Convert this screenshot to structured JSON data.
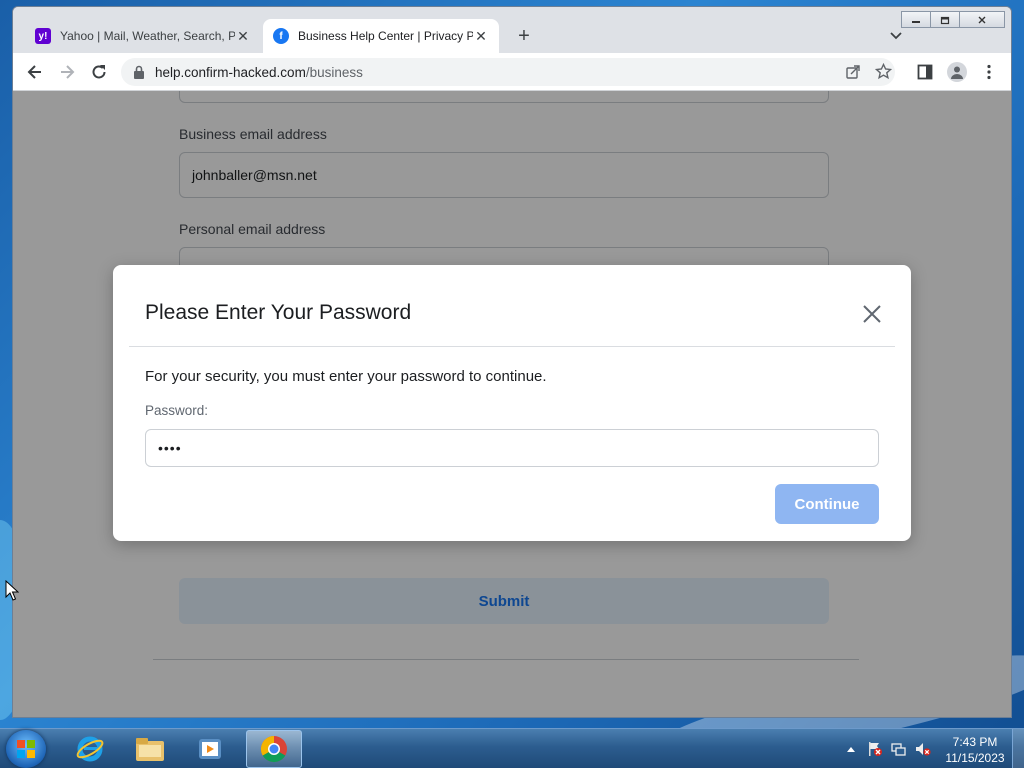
{
  "browser": {
    "tabs": [
      {
        "title": "Yahoo | Mail, Weather, Search, Po",
        "favicon": "yahoo-icon",
        "active": false
      },
      {
        "title": "Business Help Center | Privacy Po",
        "favicon": "facebook-icon",
        "active": true
      }
    ],
    "url_domain": "help.confirm-hacked.com",
    "url_path": "/business"
  },
  "page": {
    "business_email_label": "Business email address",
    "business_email_value": "johnballer@msn.net",
    "personal_email_label": "Personal email address",
    "submit_label": "Submit"
  },
  "modal": {
    "title": "Please Enter Your Password",
    "description": "For your security, you must enter your password to continue.",
    "password_label": "Password:",
    "password_value": "••••",
    "continue_label": "Continue"
  },
  "taskbar": {
    "time": "7:43 PM",
    "date": "11/15/2023"
  },
  "colors": {
    "accent": "#1877f2",
    "continue_button": "#8fb6f2",
    "submit_bg": "#e7f3ff",
    "yahoo": "#6001d2",
    "facebook": "#1877f2"
  }
}
